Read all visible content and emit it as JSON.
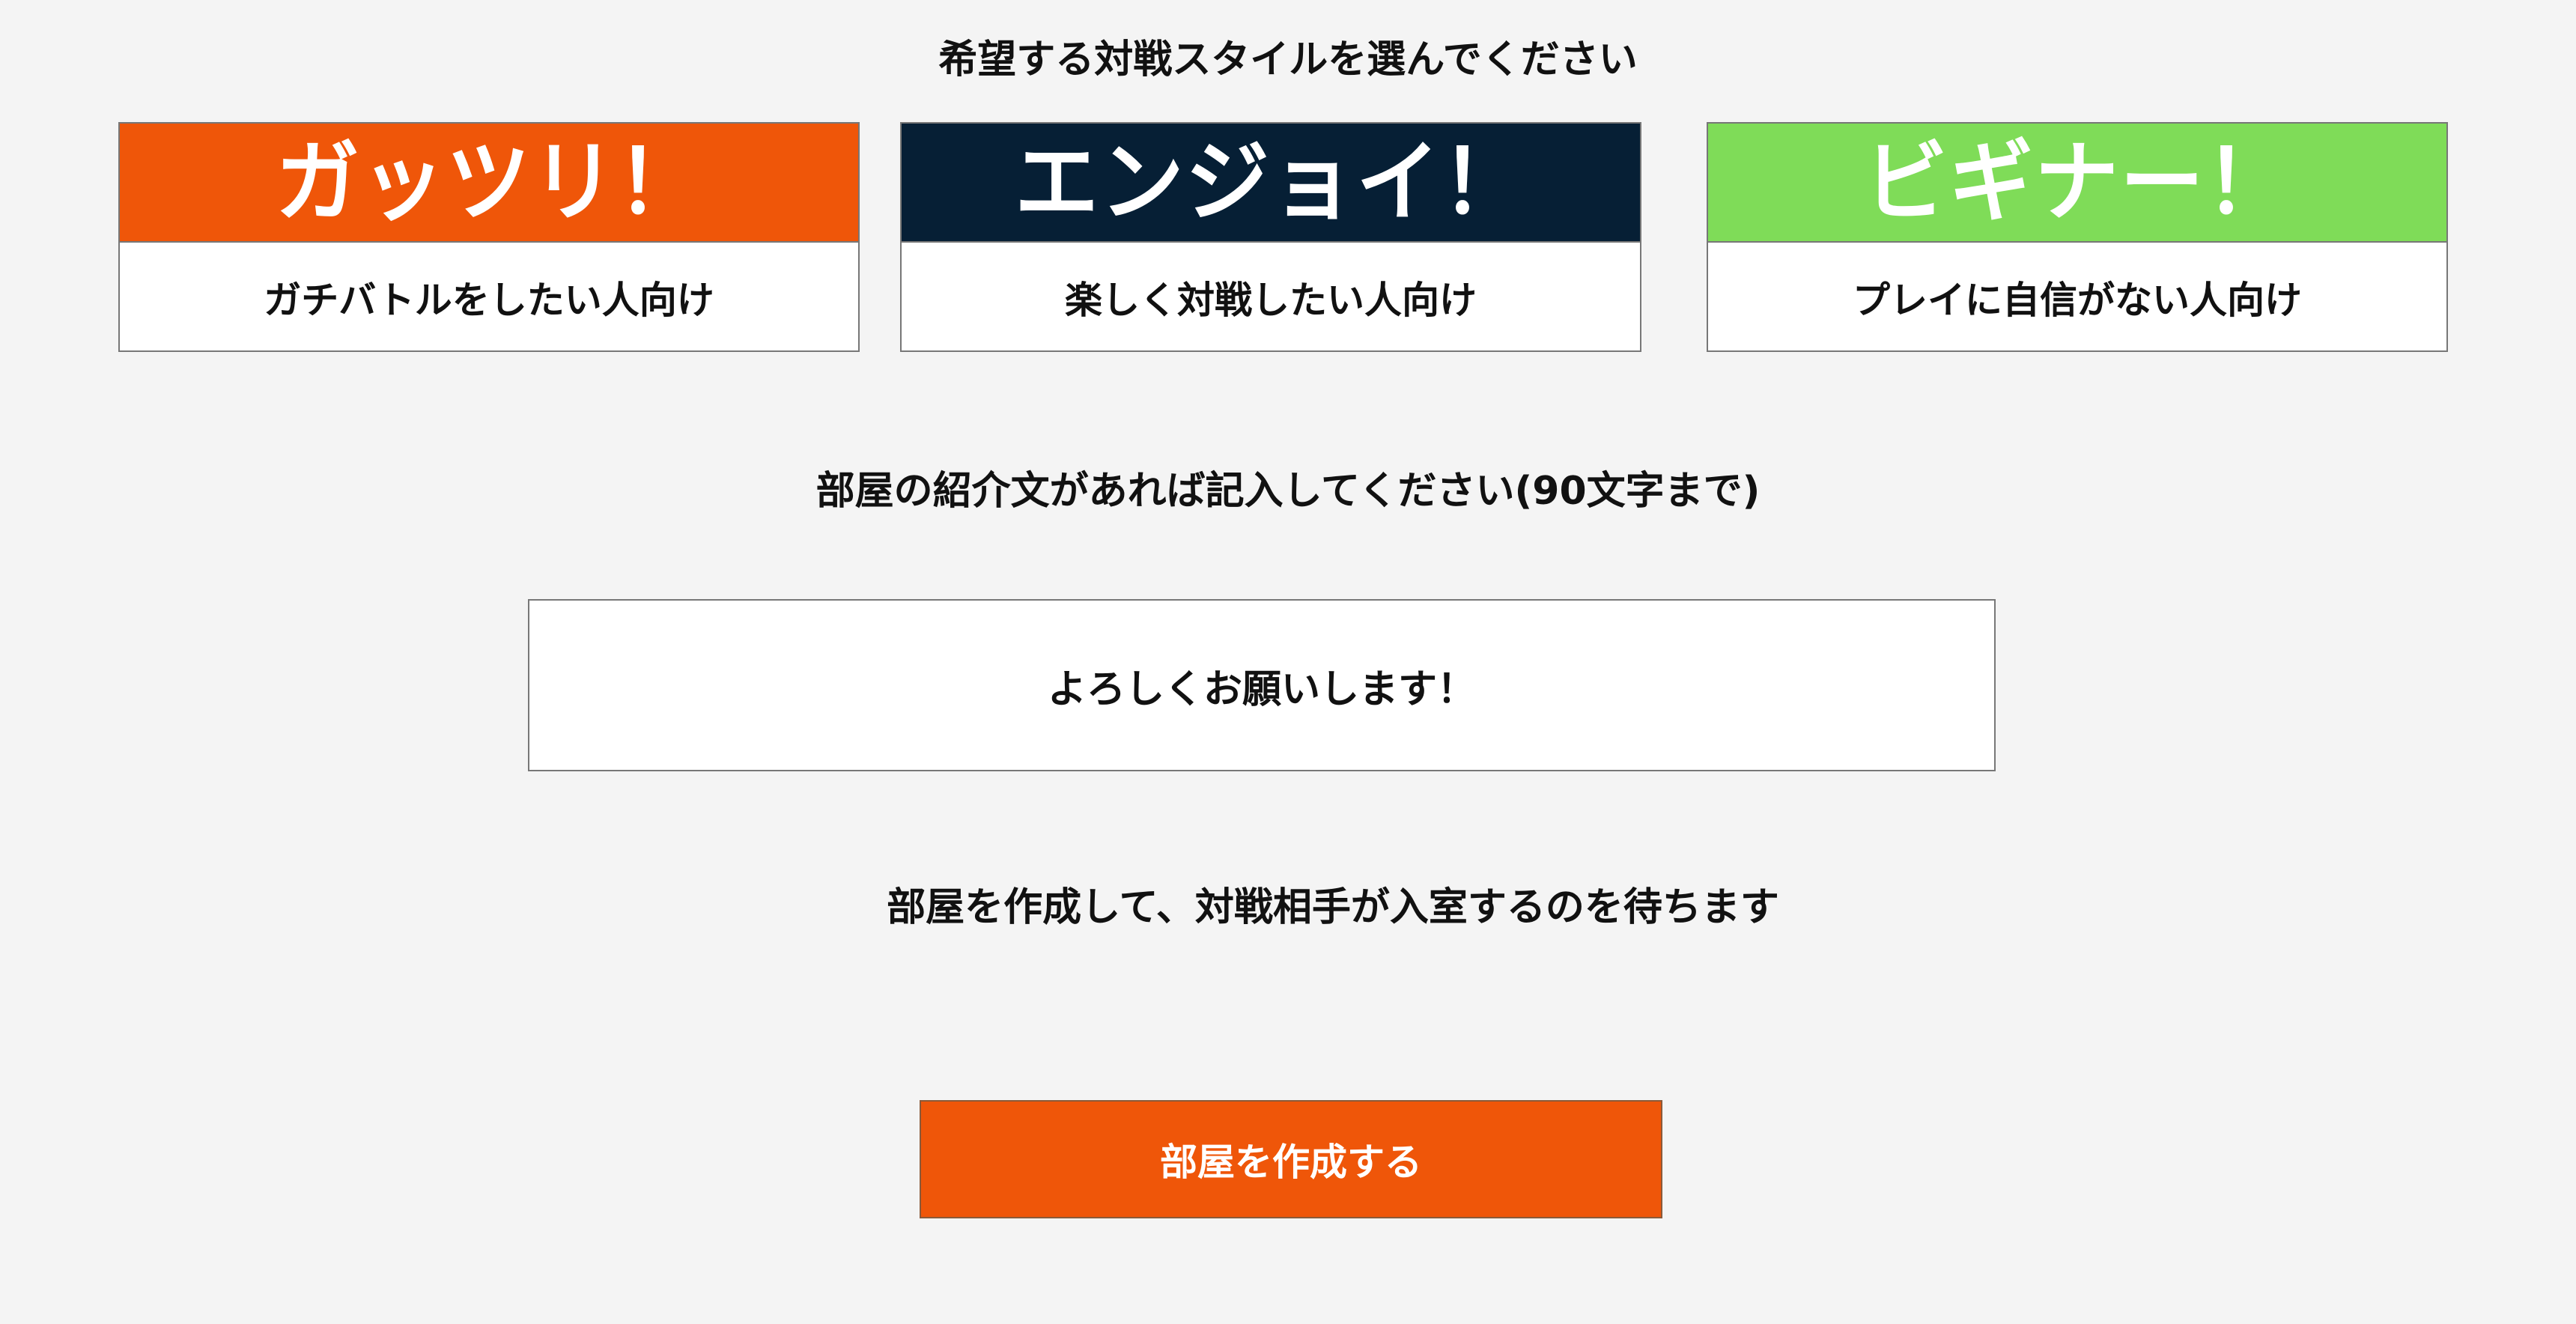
{
  "style_section": {
    "heading": "希望する対戦スタイルを選んでください",
    "options": [
      {
        "title": "ガッツリ！",
        "description": "ガチバトルをしたい人向け",
        "color": "#ef5609"
      },
      {
        "title": "エンジョイ！",
        "description": "楽しく対戦したい人向け",
        "color": "#061f35"
      },
      {
        "title": "ビギナー！",
        "description": "プレイに自信がない人向け",
        "color": "#7fdc58"
      }
    ]
  },
  "intro_section": {
    "heading": "部屋の紹介文があれば記入してください(90文字まで)",
    "value": "よろしくお願いします！"
  },
  "create_section": {
    "heading": "部屋を作成して、対戦相手が入室するのを待ちます",
    "button_label": "部屋を作成する",
    "button_color": "#ef5609"
  }
}
